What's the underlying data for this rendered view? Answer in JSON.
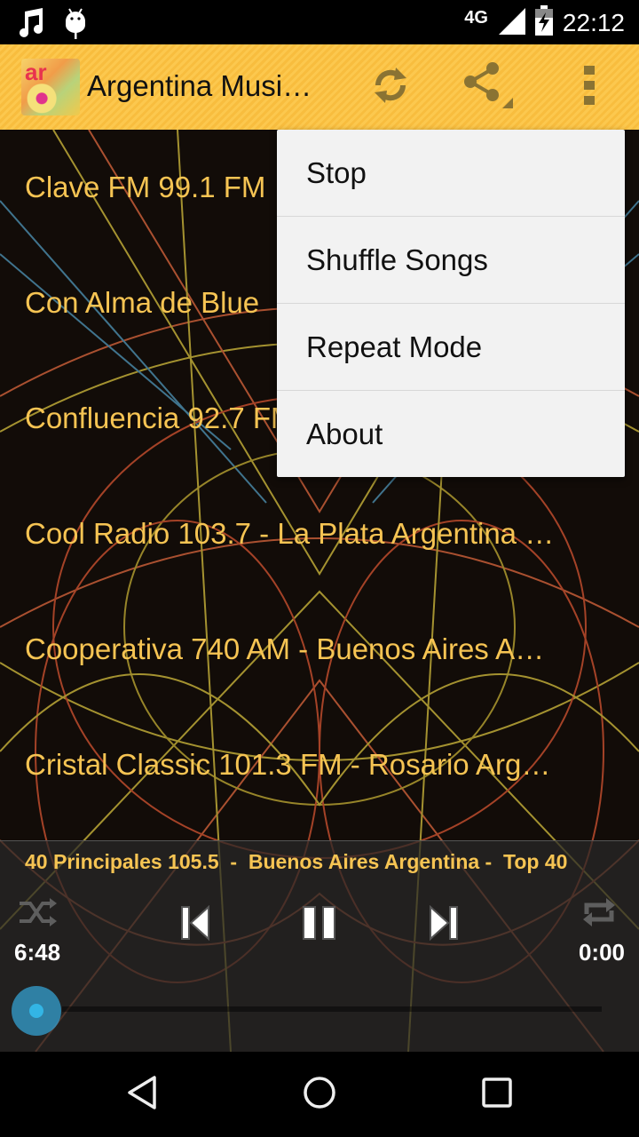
{
  "status_bar": {
    "left_icons": [
      "music-note-icon",
      "android-debug-icon"
    ],
    "network": "4G",
    "time": "22:12"
  },
  "app_bar": {
    "title": "Argentina Musi…",
    "logo_text": "ar",
    "actions": [
      "refresh-icon",
      "share-icon",
      "overflow-menu-icon"
    ],
    "background_color": "#fbc246"
  },
  "stations": [
    {
      "label": "Clave FM 99.1 FM"
    },
    {
      "label": "Con Alma de Blue"
    },
    {
      "label": "Confluencia 92.7 FM"
    },
    {
      "label": "Cool Radio 103.7 - La Plata Argentina …"
    },
    {
      "label": "Cooperativa 740 AM  - Buenos Aires A…"
    },
    {
      "label": "Cristal Classic 101.3 FM - Rosario Arg…"
    }
  ],
  "overflow_menu": {
    "items": [
      {
        "label": "Stop"
      },
      {
        "label": "Shuffle Songs"
      },
      {
        "label": "Repeat Mode"
      },
      {
        "label": "About"
      }
    ]
  },
  "player": {
    "now_playing": "40 Principales 105.5  -  Buenos Aires Argentina -  Top 40",
    "elapsed": "6:48",
    "duration": "0:00",
    "progress": 0,
    "accent_color": "#33b5e5",
    "text_color": "#f6c453"
  },
  "nav_bar": {
    "buttons": [
      "back-icon",
      "home-icon",
      "recents-icon"
    ]
  }
}
